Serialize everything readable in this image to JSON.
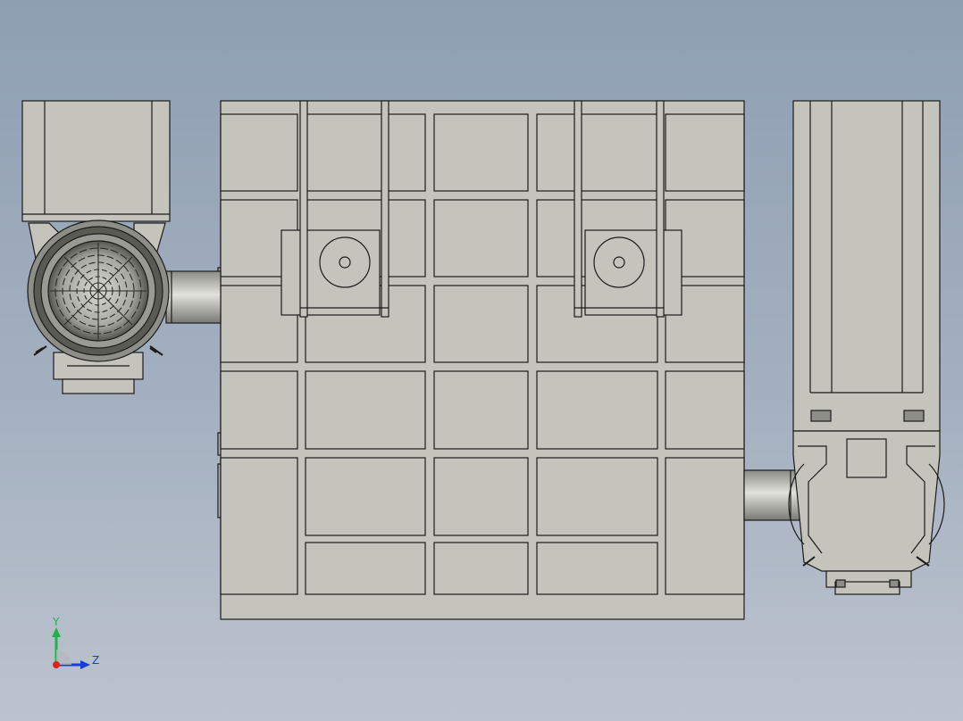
{
  "viewport": {
    "background_top": "#8e9fb2",
    "background_bottom": "#bcc3ce",
    "part_fill": "#c4c4bc",
    "edge_color": "#1b1b1b"
  },
  "triad": {
    "y_label": "Y",
    "z_label": "Z",
    "y_color": "#22b14c",
    "z_color": "#1a3fd0",
    "x_color": "#e02020"
  }
}
